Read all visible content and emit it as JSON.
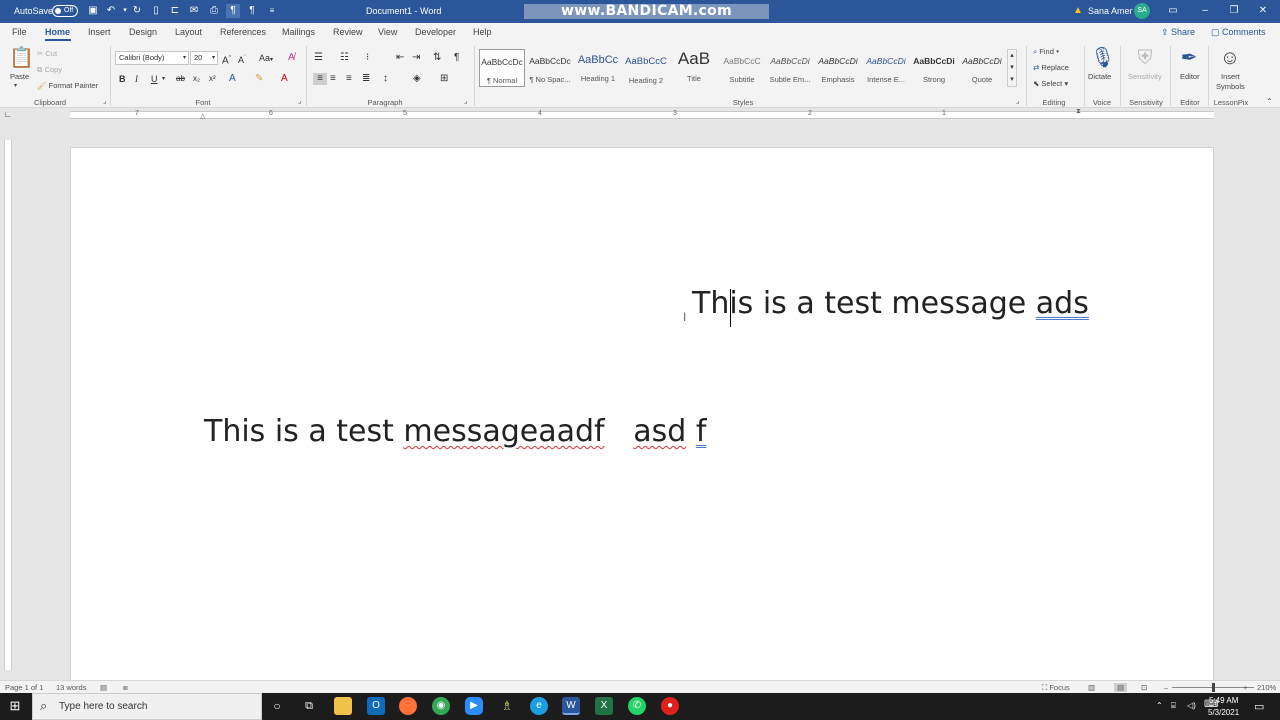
{
  "titlebar": {
    "autosave_label": "AutoSave",
    "autosave_state": "Off",
    "document_title": "Document1 - Word",
    "watermark": "www.BANDICAM.com",
    "warning_icon": "warning-icon",
    "user_name": "Sana Amer",
    "user_initials": "SA"
  },
  "menu": {
    "tabs": [
      "File",
      "Home",
      "Insert",
      "Design",
      "Layout",
      "References",
      "Mailings",
      "Review",
      "View",
      "Developer",
      "Help"
    ],
    "active_tab": "Home",
    "share_label": "Share",
    "comments_label": "Comments"
  },
  "ribbon": {
    "clipboard": {
      "paste_label": "Paste",
      "cut_label": "Cut",
      "copy_label": "Copy",
      "format_painter_label": "Format Painter",
      "group_label": "Clipboard"
    },
    "font": {
      "font_name": "Calibri (Body)",
      "font_size": "20",
      "group_label": "Font",
      "case_label": "Aa"
    },
    "paragraph": {
      "group_label": "Paragraph"
    },
    "styles": {
      "group_label": "Styles",
      "items": [
        {
          "preview": "AaBbCcDc",
          "name": "¶ Normal"
        },
        {
          "preview": "AaBbCcDc",
          "name": "¶ No Spac..."
        },
        {
          "preview": "AaBbCc",
          "name": "Heading 1"
        },
        {
          "preview": "AaBbCcC",
          "name": "Heading 2"
        },
        {
          "preview": "AaB",
          "name": "Title"
        },
        {
          "preview": "AaBbCcC",
          "name": "Subtitle"
        },
        {
          "preview": "AaBbCcDi",
          "name": "Subtle Em..."
        },
        {
          "preview": "AaBbCcDi",
          "name": "Emphasis"
        },
        {
          "preview": "AaBbCcDi",
          "name": "Intense E..."
        },
        {
          "preview": "AaBbCcDi",
          "name": "Strong"
        },
        {
          "preview": "AaBbCcDi",
          "name": "Quote"
        }
      ]
    },
    "editing": {
      "find_label": "Find",
      "replace_label": "Replace",
      "select_label": "Select",
      "group_label": "Editing"
    },
    "voice": {
      "dictate_label": "Dictate",
      "group_label": "Voice"
    },
    "sensitivity": {
      "button_label": "Sensitivity",
      "group_label": "Sensitivity"
    },
    "editor": {
      "button_label": "Editor",
      "group_label": "Editor"
    },
    "lessonpix": {
      "button_label_1": "Insert",
      "button_label_2": "Symbols",
      "group_label": "LessonPix"
    }
  },
  "ruler": {
    "numbers": [
      "7",
      "6",
      "5",
      "4",
      "3",
      "2",
      "1"
    ]
  },
  "document": {
    "line1_a": "Th",
    "line1_b": "is is a test message ",
    "line1_c": "ads",
    "line2_a": "This is a test ",
    "line2_b": "messageaadf",
    "line2_c": "   ",
    "line2_d": "asd",
    "line2_e": " ",
    "line2_f": "f"
  },
  "statusbar": {
    "page_info": "Page 1 of 1",
    "word_count": "13 words",
    "focus_label": "Focus",
    "zoom_level": "210%"
  },
  "taskbar": {
    "search_placeholder": "Type here to search",
    "time": "5:49 AM",
    "date": "5/3/2021",
    "apps": [
      "file-explorer",
      "outlook",
      "firefox",
      "chrome",
      "zoom",
      "app-green",
      "edge",
      "word",
      "excel",
      "whatsapp",
      "bandicam"
    ],
    "colors": {
      "word_blue": "#2b579a",
      "file_explorer": "#f0c14b",
      "outlook": "#0f6cbd",
      "firefox": "#ff7139",
      "chrome": "#34a853",
      "zoom": "#2d8cff",
      "edge": "#1b9de2",
      "excel": "#217346",
      "whatsapp": "#25d366",
      "bandicam": "#e0201b"
    }
  }
}
